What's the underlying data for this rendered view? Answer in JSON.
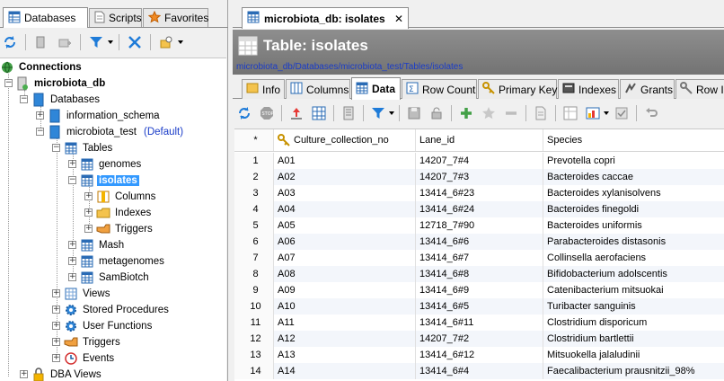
{
  "left_tabs": [
    {
      "label": "Databases",
      "icon": "databases-icon",
      "active": true
    },
    {
      "label": "Scripts",
      "icon": "scripts-icon",
      "active": false
    },
    {
      "label": "Favorites",
      "icon": "star-icon",
      "active": false
    }
  ],
  "tree": {
    "connections": "Connections",
    "server": "microbiota_db",
    "databases": "Databases",
    "information_schema": "information_schema",
    "microbiota_test": "microbiota_test",
    "default_tag": "(Default)",
    "tables": "Tables",
    "genomes": "genomes",
    "isolates": "isolates",
    "columns": "Columns",
    "indexes": "Indexes",
    "triggers_sub": "Triggers",
    "mash": "Mash",
    "metagenomes": "metagenomes",
    "sambiotch": "SamBiotch",
    "views": "Views",
    "stored_procedures": "Stored Procedures",
    "user_functions": "User Functions",
    "triggers": "Triggers",
    "events": "Events",
    "dba_views": "DBA Views"
  },
  "doc_tab": {
    "label": "microbiota_db: isolates",
    "close": "✕"
  },
  "header": {
    "title": "Table: isolates",
    "path": "microbiota_db/Databases/microbiota_test/Tables/isolates"
  },
  "sub_tabs": [
    "Info",
    "Columns",
    "Data",
    "Row Count",
    "Primary Key",
    "Indexes",
    "Grants",
    "Row Id"
  ],
  "grid": {
    "columns": [
      "*",
      "Culture_collection_no",
      "Lane_id",
      "Species"
    ],
    "rows": [
      [
        "1",
        "A01",
        "14207_7#4",
        "Prevotella copri"
      ],
      [
        "2",
        "A02",
        "14207_7#3",
        "Bacteroides caccae"
      ],
      [
        "3",
        "A03",
        "13414_6#23",
        "Bacteroides xylanisolvens"
      ],
      [
        "4",
        "A04",
        "13414_6#24",
        "Bacteroides finegoldi"
      ],
      [
        "5",
        "A05",
        "12718_7#90",
        "Bacteroides uniformis"
      ],
      [
        "6",
        "A06",
        "13414_6#6",
        "Parabacteroides distasonis"
      ],
      [
        "7",
        "A07",
        "13414_6#7",
        "Collinsella aerofaciens"
      ],
      [
        "8",
        "A08",
        "13414_6#8",
        "Bifidobacterium adolscentis"
      ],
      [
        "9",
        "A09",
        "13414_6#9",
        "Catenibacterium mitsuokai"
      ],
      [
        "10",
        "A10",
        "13414_6#5",
        "Turibacter sanguinis"
      ],
      [
        "11",
        "A11",
        "13414_6#11",
        "Clostridium disporicum"
      ],
      [
        "12",
        "A12",
        "14207_7#2",
        "Clostridium bartlettii"
      ],
      [
        "13",
        "A13",
        "13414_6#12",
        "Mitsuokella jalaludinii"
      ],
      [
        "14",
        "A14",
        "13414_6#4",
        "Faecalibacterium prausnitzii_98%"
      ]
    ]
  },
  "colors": {
    "selection": "#3399ff",
    "link_blue": "#1a3cc8",
    "title_bar": "#7f7f7f"
  }
}
